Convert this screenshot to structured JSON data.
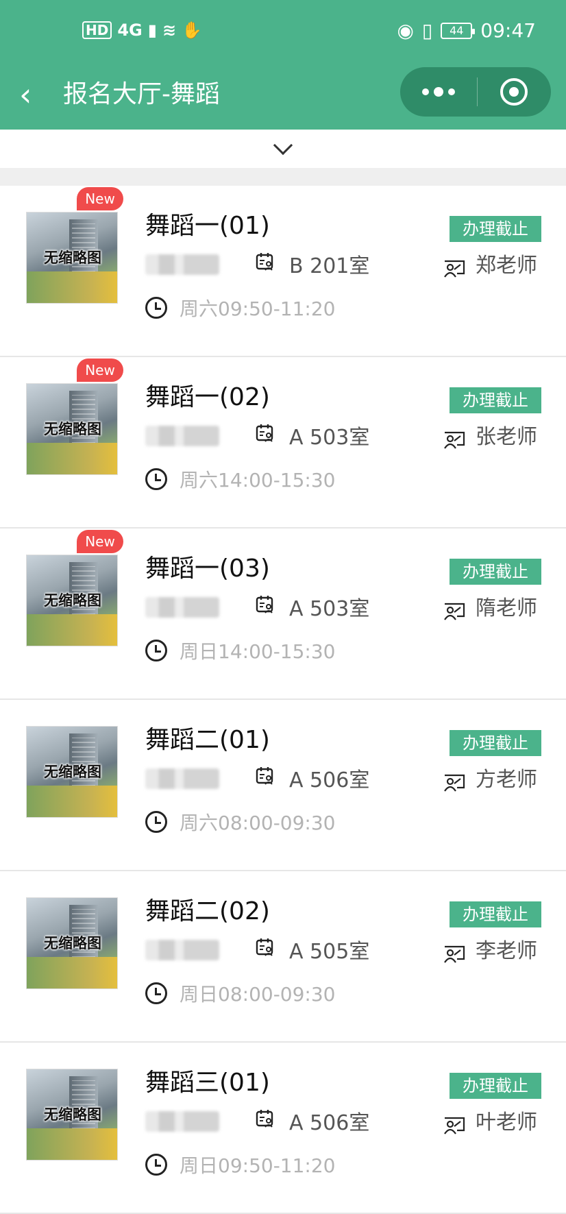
{
  "status_bar": {
    "left_icons": [
      "HD",
      "4G",
      "signal-icon",
      "wifi-icon",
      "hand-icon"
    ],
    "battery": "44",
    "time": "09:47"
  },
  "nav": {
    "back_icon": "chevron-left-icon",
    "title": "报名大厅-舞蹈",
    "more_icon": "more-dots-icon",
    "close_icon": "target-circle-icon"
  },
  "expand_icon": "chevron-down-icon",
  "colors": {
    "primary": "#4bb38b",
    "capsule": "#2f8c68",
    "new_badge": "#f04b4b",
    "muted_text": "#b3b3b3"
  },
  "courses": [
    {
      "thumb_label": "无缩略图",
      "new": true,
      "new_label": "New",
      "title": "舞蹈一(01)",
      "room": "B 201室",
      "time": "周六09:50-11:20",
      "status": "办理截止",
      "teacher": "郑老师"
    },
    {
      "thumb_label": "无缩略图",
      "new": true,
      "new_label": "New",
      "title": "舞蹈一(02)",
      "room": "A 503室",
      "time": "周六14:00-15:30",
      "status": "办理截止",
      "teacher": "张老师"
    },
    {
      "thumb_label": "无缩略图",
      "new": true,
      "new_label": "New",
      "title": "舞蹈一(03)",
      "room": "A 503室",
      "time": "周日14:00-15:30",
      "status": "办理截止",
      "teacher": "隋老师"
    },
    {
      "thumb_label": "无缩略图",
      "new": false,
      "new_label": "",
      "title": "舞蹈二(01)",
      "room": "A 506室",
      "time": "周六08:00-09:30",
      "status": "办理截止",
      "teacher": "方老师"
    },
    {
      "thumb_label": "无缩略图",
      "new": false,
      "new_label": "",
      "title": "舞蹈二(02)",
      "room": "A 505室",
      "time": "周日08:00-09:30",
      "status": "办理截止",
      "teacher": "李老师"
    },
    {
      "thumb_label": "无缩略图",
      "new": false,
      "new_label": "",
      "title": "舞蹈三(01)",
      "room": "A 506室",
      "time": "周日09:50-11:20",
      "status": "办理截止",
      "teacher": "叶老师"
    }
  ]
}
